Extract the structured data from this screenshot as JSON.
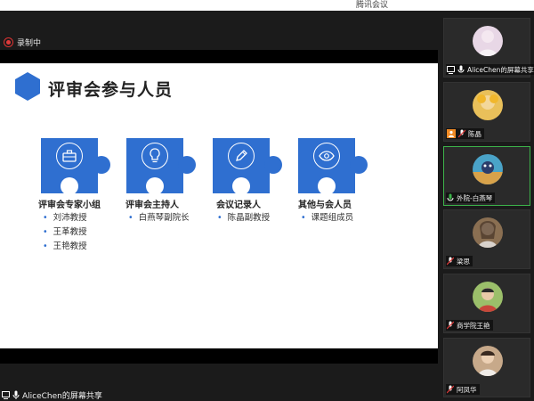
{
  "window": {
    "top_text": "腾讯会议"
  },
  "recording": {
    "label": "录制中"
  },
  "slide": {
    "title": "评审会参与人员",
    "cards": [
      {
        "icon": "briefcase-icon",
        "heading": "评审会专家小组",
        "items": [
          "刘沛教授",
          "王革教授",
          "王艳教授"
        ]
      },
      {
        "icon": "lightbulb-icon",
        "heading": "评审会主持人",
        "items": [
          "白燕琴副院长"
        ]
      },
      {
        "icon": "pencil-icon",
        "heading": "会议记录人",
        "items": [
          "陈晶副教授"
        ]
      },
      {
        "icon": "eye-icon",
        "heading": "其他与会人员",
        "items": [
          "课题组成员"
        ]
      }
    ]
  },
  "share": {
    "label": "AliceChen的屏幕共享"
  },
  "participants": [
    {
      "name": "AliceChen的屏幕共享",
      "badge": "screen-share-icon",
      "avatar_color": "#e8d7e6"
    },
    {
      "name": "陈晶",
      "badge": "host-badge-icon",
      "avatar_color": "#e9c05a"
    },
    {
      "name": "外院-白燕琴",
      "badge": "mic-icon",
      "avatar_color": "#4aa3c8",
      "active": true
    },
    {
      "name": "梁思",
      "badge": "mic-muted-icon",
      "avatar_color": "#8a6f52"
    },
    {
      "name": "商学院王艳",
      "badge": "mic-muted-icon",
      "avatar_color": "#9bbf6a"
    },
    {
      "name": "阿凤华",
      "badge": "mic-muted-icon",
      "avatar_color": "#c7a98a"
    }
  ],
  "colors": {
    "accent_blue": "#2f6fd0",
    "recording_red": "#e03a3a",
    "active_green": "#3cb34a"
  }
}
